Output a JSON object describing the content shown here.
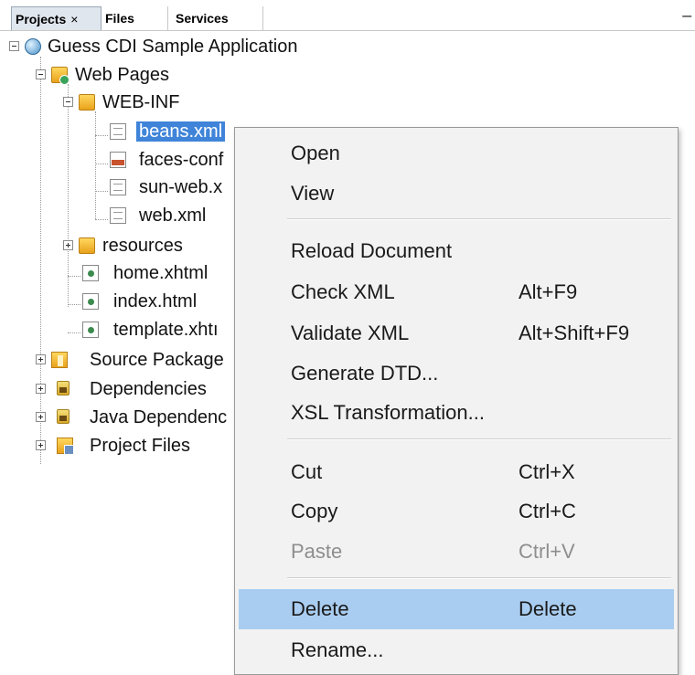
{
  "tabs": [
    {
      "label": "Projects",
      "close": "×"
    },
    {
      "label": "Files"
    },
    {
      "label": "Services"
    }
  ],
  "window_minimize": "−",
  "tree": {
    "root": "Guess CDI Sample Application",
    "web_pages": "Web Pages",
    "web_inf": "WEB-INF",
    "beans": "beans.xml",
    "faces": "faces-conf",
    "sunweb": "sun-web.x",
    "webxml": "web.xml",
    "resources": "resources",
    "home": "home.xhtml",
    "index": "index.html",
    "template": "template.xhtı",
    "source": "Source Package",
    "deps": "Dependencies",
    "javadeps": "Java Dependenc",
    "projfiles": "Project Files"
  },
  "menu": {
    "open": "Open",
    "view": "View",
    "reload": "Reload Document",
    "check": {
      "label": "Check XML",
      "key": "Alt+F9"
    },
    "validate": {
      "label": "Validate XML",
      "key": "Alt+Shift+F9"
    },
    "dtd": "Generate DTD...",
    "xsl": "XSL Transformation...",
    "cut": {
      "label": "Cut",
      "key": "Ctrl+X"
    },
    "copy": {
      "label": "Copy",
      "key": "Ctrl+C"
    },
    "paste": {
      "label": "Paste",
      "key": "Ctrl+V"
    },
    "delete": {
      "label": "Delete",
      "key": "Delete"
    },
    "rename": "Rename..."
  },
  "colors": {
    "selection": "#3f84d9",
    "menu_highlight": "#a9cdf0",
    "menu_bg": "#f2f2f2"
  }
}
